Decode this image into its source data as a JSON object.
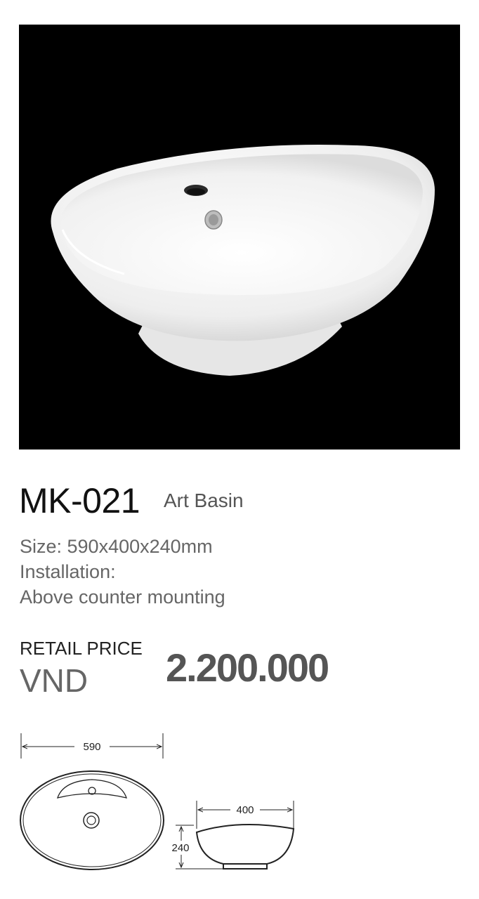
{
  "product": {
    "model": "MK-021",
    "type": "Art Basin",
    "size_line": "Size: 590x400x240mm",
    "installation_label": "Installation:",
    "installation_value": "Above counter mounting"
  },
  "pricing": {
    "label": "RETAIL PRICE",
    "currency": "VND",
    "amount": "2.200.000"
  },
  "drawing": {
    "top_view_width": "590",
    "side_view_width": "400",
    "side_view_height": "240"
  },
  "colors": {
    "photo_background": "#000000",
    "price_text": "#555555"
  }
}
